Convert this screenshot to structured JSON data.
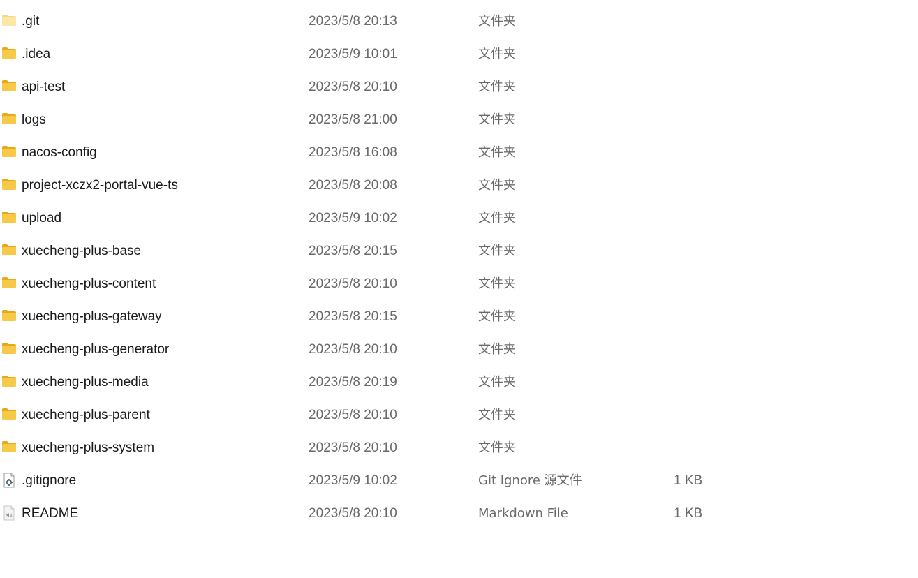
{
  "files": [
    {
      "name": ".git",
      "date": "2023/5/8 20:13",
      "type": "文件夹",
      "size": "",
      "icon": "folder-hidden-icon"
    },
    {
      "name": ".idea",
      "date": "2023/5/9 10:01",
      "type": "文件夹",
      "size": "",
      "icon": "folder-icon"
    },
    {
      "name": "api-test",
      "date": "2023/5/8 20:10",
      "type": "文件夹",
      "size": "",
      "icon": "folder-icon"
    },
    {
      "name": "logs",
      "date": "2023/5/8 21:00",
      "type": "文件夹",
      "size": "",
      "icon": "folder-icon"
    },
    {
      "name": "nacos-config",
      "date": "2023/5/8 16:08",
      "type": "文件夹",
      "size": "",
      "icon": "folder-icon"
    },
    {
      "name": "project-xczx2-portal-vue-ts",
      "date": "2023/5/8 20:08",
      "type": "文件夹",
      "size": "",
      "icon": "folder-icon"
    },
    {
      "name": "upload",
      "date": "2023/5/9 10:02",
      "type": "文件夹",
      "size": "",
      "icon": "folder-icon"
    },
    {
      "name": "xuecheng-plus-base",
      "date": "2023/5/8 20:15",
      "type": "文件夹",
      "size": "",
      "icon": "folder-icon"
    },
    {
      "name": "xuecheng-plus-content",
      "date": "2023/5/8 20:10",
      "type": "文件夹",
      "size": "",
      "icon": "folder-icon"
    },
    {
      "name": "xuecheng-plus-gateway",
      "date": "2023/5/8 20:15",
      "type": "文件夹",
      "size": "",
      "icon": "folder-icon"
    },
    {
      "name": "xuecheng-plus-generator",
      "date": "2023/5/8 20:10",
      "type": "文件夹",
      "size": "",
      "icon": "folder-icon"
    },
    {
      "name": "xuecheng-plus-media",
      "date": "2023/5/8 20:19",
      "type": "文件夹",
      "size": "",
      "icon": "folder-icon"
    },
    {
      "name": "xuecheng-plus-parent",
      "date": "2023/5/8 20:10",
      "type": "文件夹",
      "size": "",
      "icon": "folder-icon"
    },
    {
      "name": "xuecheng-plus-system",
      "date": "2023/5/8 20:10",
      "type": "文件夹",
      "size": "",
      "icon": "folder-icon"
    },
    {
      "name": ".gitignore",
      "date": "2023/5/9 10:02",
      "type": "Git Ignore 源文件",
      "size": "1 KB",
      "icon": "settings-file-icon"
    },
    {
      "name": "README",
      "date": "2023/5/8 20:10",
      "type": "Markdown File",
      "size": "1 KB",
      "icon": "markdown-file-icon"
    }
  ],
  "colors": {
    "folder": "#f7c948",
    "folder_dark": "#e8a917",
    "folder_hidden": "#fbe7a6",
    "name_text": "#1b1b1b",
    "detail_text": "#6a6a6a"
  }
}
